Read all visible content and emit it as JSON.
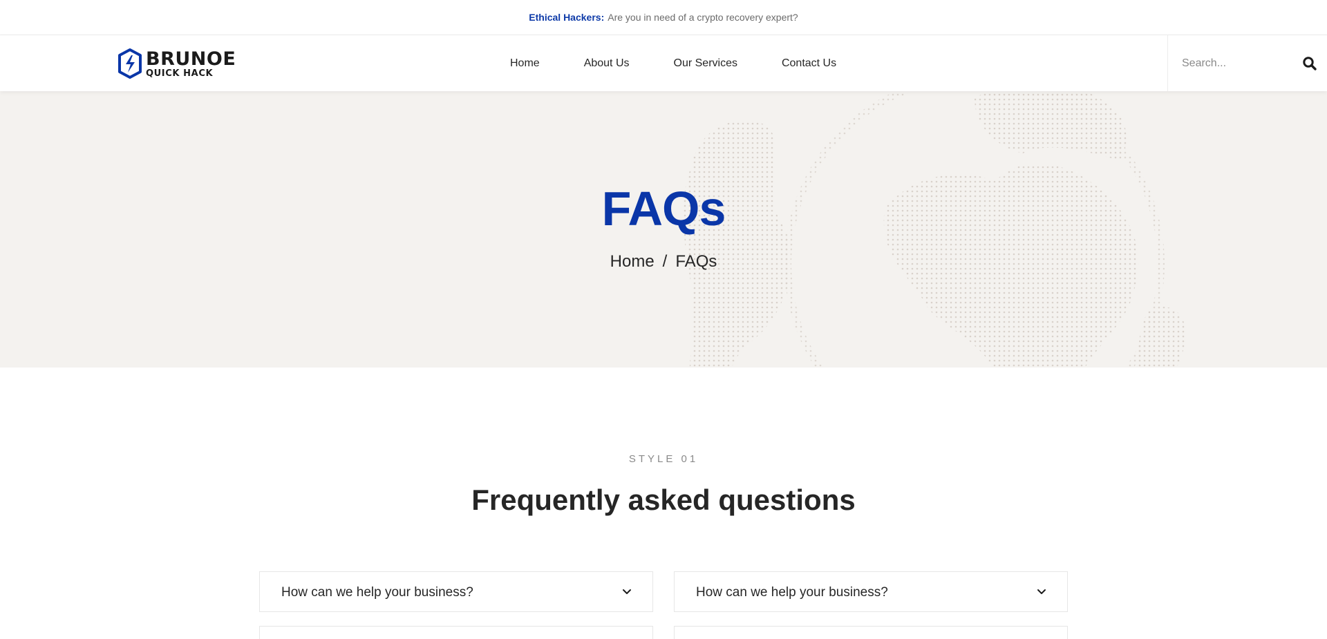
{
  "topbar": {
    "highlight": "Ethical Hackers:",
    "message": "Are you in need of a crypto recovery expert?"
  },
  "brand": {
    "name": "BRUNOE",
    "tagline": "QUICK HACK",
    "accent_color": "#0a36a8",
    "icon": "shield-bolt-icon"
  },
  "nav": {
    "items": [
      "Home",
      "About Us",
      "Our Services",
      "Contact Us"
    ]
  },
  "search": {
    "placeholder": "Search...",
    "value": "",
    "icon": "search-icon"
  },
  "hero": {
    "title": "FAQs",
    "breadcrumb": [
      "Home",
      "/",
      "FAQs"
    ],
    "background_color": "#f4f2ef"
  },
  "faq": {
    "eyebrow": "STYLE 01",
    "title": "Frequently asked questions",
    "items": [
      {
        "question": "How can we help your business?",
        "icon": "chevron-down-icon"
      },
      {
        "question": "How can we help your business?",
        "icon": "chevron-down-icon"
      }
    ]
  }
}
